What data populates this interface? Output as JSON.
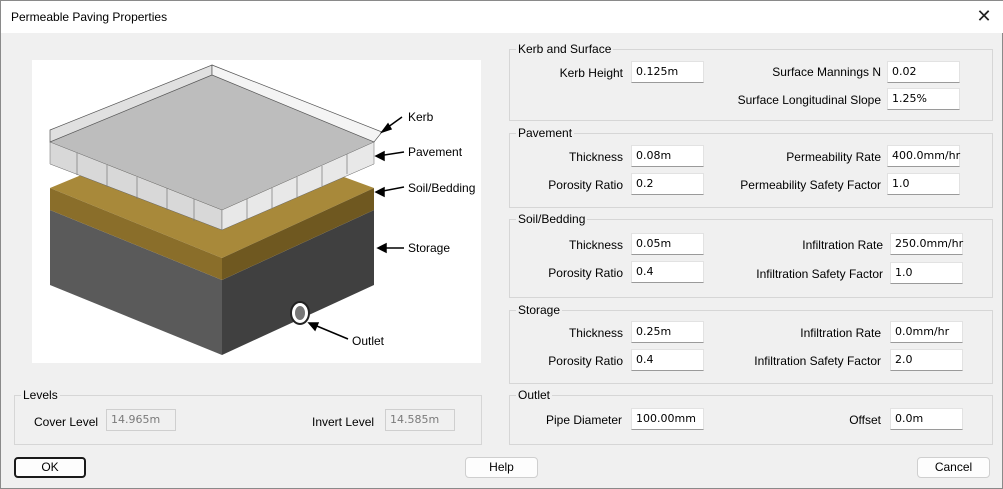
{
  "window": {
    "title": "Permeable Paving Properties",
    "close_icon": "close-icon"
  },
  "illustration": {
    "labels": [
      "Kerb",
      "Pavement",
      "Soil/Bedding",
      "Storage",
      "Outlet"
    ]
  },
  "levels": {
    "title": "Levels",
    "cover_label": "Cover Level",
    "cover_value": "14.965m",
    "invert_label": "Invert Level",
    "invert_value": "14.585m"
  },
  "kerb": {
    "title": "Kerb and Surface",
    "kerb_height_label": "Kerb Height",
    "kerb_height": "0.125m",
    "mannings_label": "Surface Mannings N",
    "mannings": "0.02",
    "slope_label": "Surface Longitudinal Slope",
    "slope": "1.25%"
  },
  "pavement": {
    "title": "Pavement",
    "thickness_label": "Thickness",
    "thickness": "0.08m",
    "porosity_label": "Porosity Ratio",
    "porosity": "0.2",
    "rate_label": "Permeability Rate",
    "rate": "400.0mm/hr",
    "factor_label": "Permeability Safety Factor",
    "factor": "1.0"
  },
  "soil": {
    "title": "Soil/Bedding",
    "thickness_label": "Thickness",
    "thickness": "0.05m",
    "porosity_label": "Porosity Ratio",
    "porosity": "0.4",
    "rate_label": "Infiltration Rate",
    "rate": "250.0mm/hr",
    "factor_label": "Infiltration Safety Factor",
    "factor": "1.0"
  },
  "storage": {
    "title": "Storage",
    "thickness_label": "Thickness",
    "thickness": "0.25m",
    "porosity_label": "Porosity Ratio",
    "porosity": "0.4",
    "rate_label": "Infiltration Rate",
    "rate": "0.0mm/hr",
    "factor_label": "Infiltration Safety Factor",
    "factor": "2.0"
  },
  "outlet": {
    "title": "Outlet",
    "diameter_label": "Pipe Diameter",
    "diameter": "100.00mm",
    "offset_label": "Offset",
    "offset": "0.0m"
  },
  "buttons": {
    "ok": "OK",
    "help": "Help",
    "cancel": "Cancel"
  }
}
